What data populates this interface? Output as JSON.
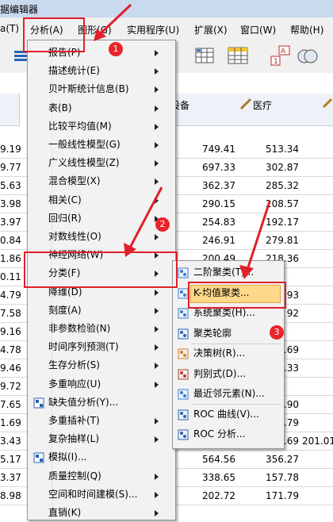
{
  "window": {
    "title": "据编辑器"
  },
  "menubar": {
    "items": [
      "a(T)",
      "分析(A)",
      "图形(G)",
      "实用程序(U)",
      "扩展(X)",
      "窗口(W)",
      "帮助(H)"
    ]
  },
  "grid": {
    "headers": [
      "设备",
      "医疗"
    ],
    "left_col": [
      "9.19",
      "9.77",
      "5.63",
      "3.98",
      "3.97",
      "0.84",
      "1.86",
      "0.11",
      "4.79",
      "7.58",
      "9.16",
      "4.78",
      "9.46",
      "9.72",
      "7.65",
      "1.69",
      "3.43",
      "5.17",
      "3.37",
      "8.98"
    ],
    "col_device": [
      "749.41",
      "697.33",
      "362.37",
      "290.15",
      "254.83",
      "246.91",
      "200.49",
      "",
      "",
      "",
      "",
      "",
      "",
      "",
      "",
      "",
      "",
      "564.56",
      "338.65",
      "202.72"
    ],
    "col_medical": [
      "513.34",
      "302.87",
      "285.32",
      "208.57",
      "192.17",
      "279.81",
      "218.36",
      "",
      "5.93",
      "92",
      "",
      "5.69",
      "5.33",
      "",
      "7.90",
      "0.79",
      "4.69",
      "356.27",
      "157.78",
      "171.79"
    ],
    "col_right": [
      "",
      "",
      "",
      "",
      "",
      "",
      "",
      "",
      "",
      "",
      "",
      "",
      "",
      "",
      "",
      "",
      "201.01",
      "",
      "",
      ""
    ]
  },
  "analyze_menu": {
    "items": [
      {
        "label": "报告(P)",
        "arrow": true
      },
      {
        "label": "描述统计(E)",
        "arrow": true
      },
      {
        "label": "贝叶斯统计信息(B)",
        "arrow": true
      },
      {
        "label": "表(B)",
        "arrow": true
      },
      {
        "label": "比较平均值(M)",
        "arrow": true
      },
      {
        "label": "一般线性模型(G)",
        "arrow": true
      },
      {
        "label": "广义线性模型(Z)",
        "arrow": true
      },
      {
        "label": "混合模型(X)",
        "arrow": true
      },
      {
        "label": "相关(C)",
        "arrow": true
      },
      {
        "label": "回归(R)",
        "arrow": true
      },
      {
        "label": "对数线性(O)",
        "arrow": true
      },
      {
        "label": "神经网络(W)",
        "arrow": true
      },
      {
        "label": "分类(F)",
        "arrow": true
      },
      {
        "label": "降维(D)",
        "arrow": true
      },
      {
        "label": "刻度(A)",
        "arrow": true
      },
      {
        "label": "非参数检验(N)",
        "arrow": true
      },
      {
        "label": "时间序列预测(T)",
        "arrow": true
      },
      {
        "label": "生存分析(S)",
        "arrow": true
      },
      {
        "label": "多重响应(U)",
        "arrow": true
      },
      {
        "label": "缺失值分析(Y)...",
        "arrow": false
      },
      {
        "label": "多重插补(T)",
        "arrow": true
      },
      {
        "label": "复杂抽样(L)",
        "arrow": true
      },
      {
        "label": "模拟(I)...",
        "arrow": false
      },
      {
        "label": "质量控制(Q)",
        "arrow": true
      },
      {
        "label": "空间和时间建模(S)...",
        "arrow": true
      },
      {
        "label": "直销(K)",
        "arrow": true
      }
    ]
  },
  "classify_menu": {
    "items": [
      {
        "label": "二阶聚类(T)..."
      },
      {
        "label": "K-均值聚类..."
      },
      {
        "label": "系统聚类(H)..."
      },
      {
        "label": "聚类轮廓"
      },
      {
        "label": "决策树(R)..."
      },
      {
        "label": "判别式(D)..."
      },
      {
        "label": "最近邻元素(N)..."
      },
      {
        "label": "ROC 曲线(V)..."
      },
      {
        "label": "ROC 分析..."
      }
    ]
  },
  "callouts": [
    "1",
    "2",
    "3"
  ],
  "colors": {
    "highlight": "#ffd98a",
    "annotation_red": "#e0202a",
    "menu_bg": "#f2f2f2"
  }
}
